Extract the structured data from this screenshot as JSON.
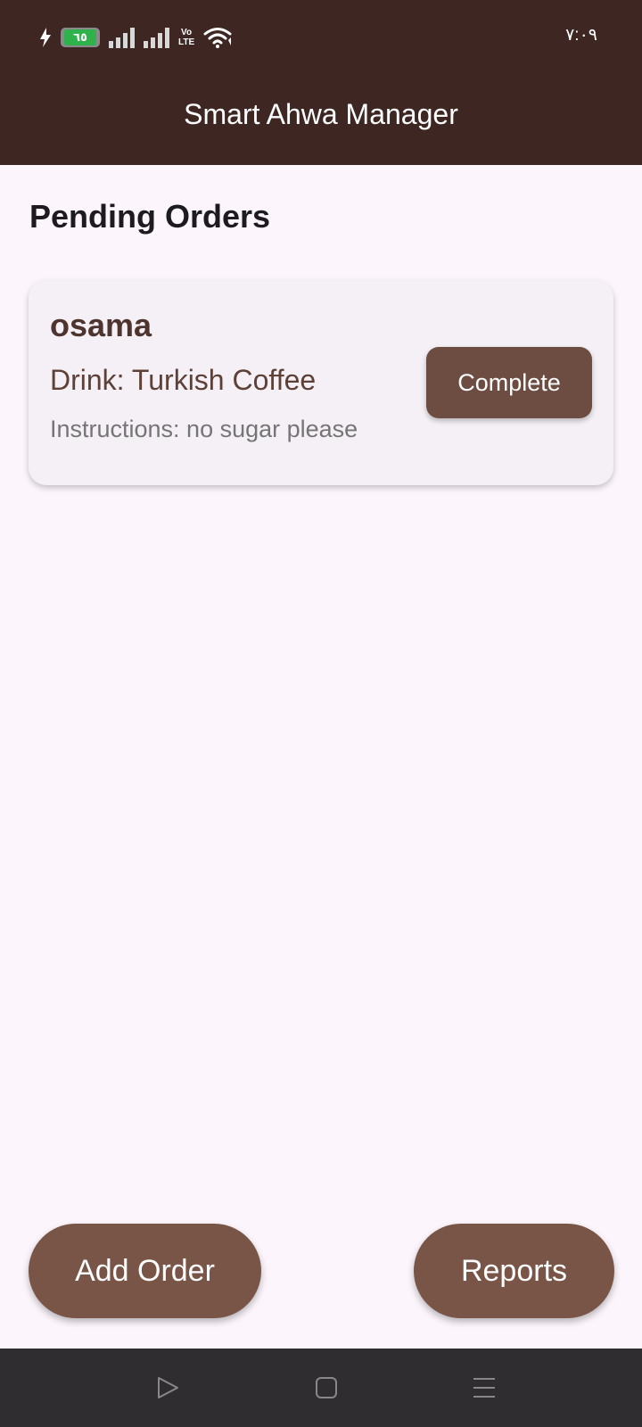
{
  "status_bar": {
    "battery_level": "٦٥",
    "network_label_top": "Vo",
    "network_label_bottom": "LTE",
    "time": "٧:٠٩"
  },
  "app_bar": {
    "title": "Smart Ahwa Manager"
  },
  "main": {
    "section_title": "Pending Orders",
    "orders": [
      {
        "customer": "osama",
        "drink": "Drink: Turkish Coffee",
        "instructions": "Instructions: no sugar please",
        "action_label": "Complete"
      }
    ]
  },
  "actions": {
    "add_order_label": "Add Order",
    "reports_label": "Reports"
  },
  "colors": {
    "app_bar": "#3e2723",
    "background": "#fcf6fc",
    "card": "#f4f0f5",
    "button": "#6d4c41",
    "fab": "#795548",
    "nav_bar": "#302d30"
  },
  "icons": {
    "status": [
      "charging-icon",
      "battery-icon",
      "signal-icon",
      "signal-icon",
      "volte-icon",
      "wifi-icon"
    ],
    "navigation": [
      "back-icon",
      "home-icon",
      "recents-icon"
    ]
  }
}
